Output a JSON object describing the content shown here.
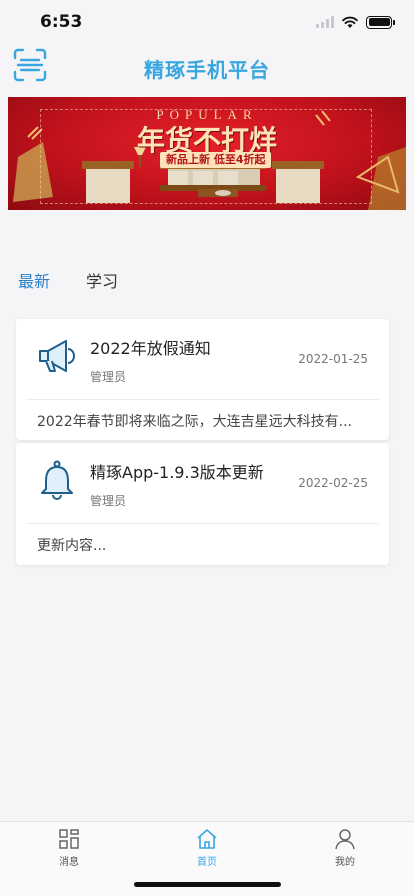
{
  "status_bar": {
    "time": "6:53"
  },
  "nav": {
    "title": "精琢手机平台",
    "scan_icon": "scan-icon"
  },
  "banner": {
    "popular": "POPULAR",
    "headline": "年货不打烊",
    "subline": "新品上新 低至4折起"
  },
  "tabs": [
    {
      "label": "最新",
      "active": true
    },
    {
      "label": "学习",
      "active": false
    }
  ],
  "notices": [
    {
      "icon": "megaphone-icon",
      "title": "2022年放假通知",
      "author": "管理员",
      "date": "2022-01-25",
      "excerpt": "2022年春节即将来临之际，大连吉星远大科技有..."
    },
    {
      "icon": "bell-icon",
      "title": "精琢App-1.9.3版本更新",
      "author": "管理员",
      "date": "2022-02-25",
      "excerpt": "更新内容..."
    }
  ],
  "tabbar": [
    {
      "label": "消息",
      "icon": "grid-icon",
      "active": false
    },
    {
      "label": "首页",
      "icon": "home-icon",
      "active": true
    },
    {
      "label": "我的",
      "icon": "user-icon",
      "active": false
    }
  ],
  "colors": {
    "accent": "#3aa6e0",
    "tab_active": "#2a7fc6",
    "banner_red": "#c1121c"
  }
}
